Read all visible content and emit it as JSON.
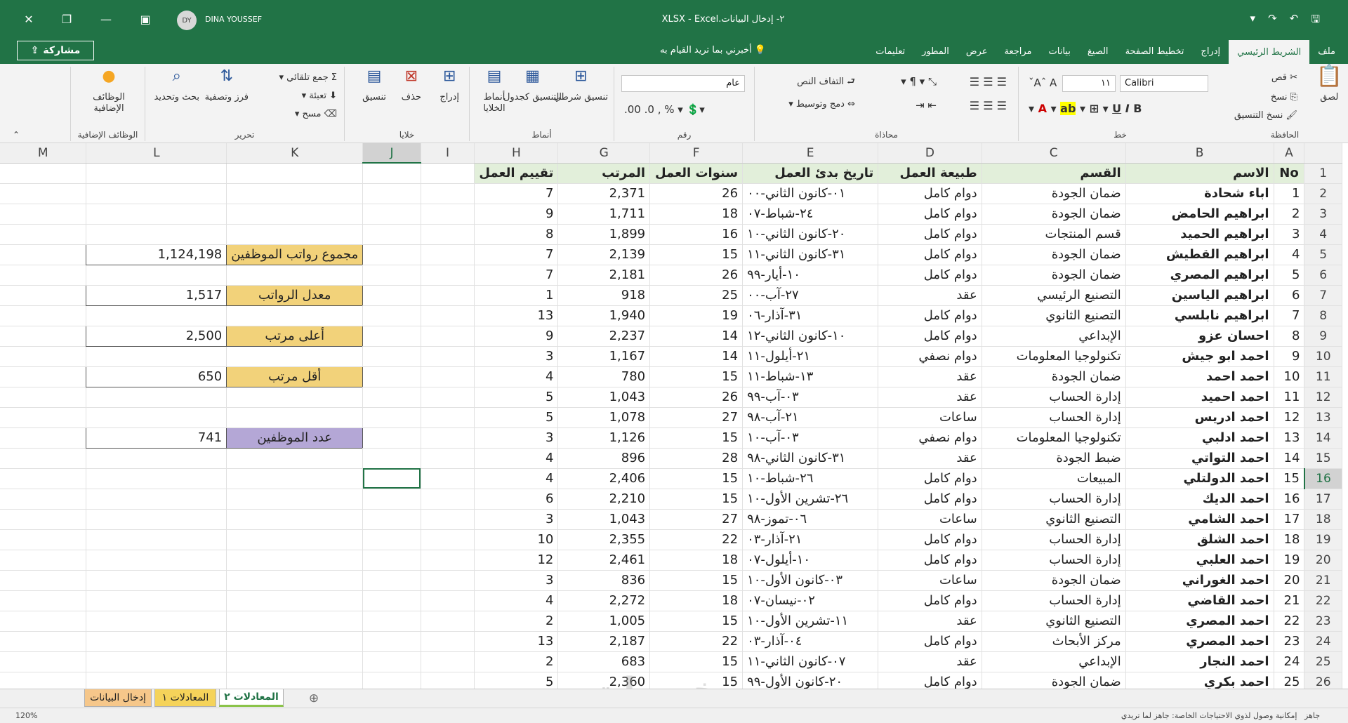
{
  "titlebar": {
    "user_initials": "DY",
    "user_name": "DINA YOUSSEF",
    "doc_title": "٢- إدخال البيانات.XLSX  -  Excel"
  },
  "share_label": "مشاركة",
  "tellme": "أخبرني بما تريد القيام به",
  "tabs": [
    "ملف",
    "الشريط الرئيسي",
    "إدراج",
    "تخطيط الصفحة",
    "الصيغ",
    "بيانات",
    "مراجعة",
    "عرض",
    "المطور",
    "تعليمات"
  ],
  "ribbon": {
    "clipboard": {
      "label": "الحافظة",
      "paste": "لصق",
      "cut": "قص",
      "copy": "نسخ",
      "format_painter": "نسخ التنسيق"
    },
    "font": {
      "label": "خط",
      "name": "Calibri",
      "size": "١١"
    },
    "alignment": {
      "label": "محاذاة",
      "wrap": "التفاف النص",
      "merge": "دمج وتوسيط"
    },
    "number": {
      "label": "رقم",
      "format": "عام"
    },
    "styles": {
      "label": "أنماط",
      "conditional": "تنسيق شرطي",
      "table": "التنسيق كجدول",
      "cell": "أنماط الخلايا"
    },
    "cells": {
      "label": "خلايا",
      "insert": "إدراج",
      "delete": "حذف",
      "format": "تنسيق"
    },
    "editing": {
      "label": "تحرير",
      "autosum": "جمع تلقائي",
      "fill": "تعبئة",
      "clear": "مسح",
      "sort": "فرز وتصفية",
      "find": "بحث وتحديد"
    },
    "addins": {
      "label": "الوظائف الإضافية",
      "btn": "الوظائف الإضافية"
    }
  },
  "columns": [
    "A",
    "B",
    "C",
    "D",
    "E",
    "F",
    "G",
    "H",
    "I",
    "J",
    "K",
    "L",
    "M"
  ],
  "header_row": {
    "no": "No",
    "name": "الاسم",
    "dept": "القسم",
    "type": "طبيعة العمل",
    "start": "تاريخ بدئ العمل",
    "years": "سنوات العمل",
    "salary": "المرتب",
    "rating": "تقييم العمل"
  },
  "rows": [
    {
      "r": "2",
      "no": "1",
      "name": "اباء شحادة",
      "dept": "ضمان الجودة",
      "type": "دوام كامل",
      "start": "٠١-كانون الثاني-٠٠",
      "years": "26",
      "salary": "2,371",
      "rating": "7"
    },
    {
      "r": "3",
      "no": "2",
      "name": "ابراهيم الحامض",
      "dept": "ضمان الجودة",
      "type": "دوام كامل",
      "start": "٢٤-شباط-٠٧",
      "years": "18",
      "salary": "1,711",
      "rating": "9"
    },
    {
      "r": "4",
      "no": "3",
      "name": "ابراهيم الحميد",
      "dept": "قسم المنتجات",
      "type": "دوام كامل",
      "start": "٢٠-كانون الثاني-١٠",
      "years": "16",
      "salary": "1,899",
      "rating": "8"
    },
    {
      "r": "5",
      "no": "4",
      "name": "ابراهيم القطيش",
      "dept": "ضمان الجودة",
      "type": "دوام كامل",
      "start": "٣١-كانون الثاني-١١",
      "years": "15",
      "salary": "2,139",
      "rating": "7"
    },
    {
      "r": "6",
      "no": "5",
      "name": "ابراهيم المصري",
      "dept": "ضمان الجودة",
      "type": "دوام كامل",
      "start": "١٠-أيار-٩٩",
      "years": "26",
      "salary": "2,181",
      "rating": "7"
    },
    {
      "r": "7",
      "no": "6",
      "name": "ابراهيم الياسين",
      "dept": "التصنيع الرئيسي",
      "type": "عقد",
      "start": "٢٧-آب-٠٠",
      "years": "25",
      "salary": "918",
      "rating": "1"
    },
    {
      "r": "8",
      "no": "7",
      "name": "ابراهيم نابلسي",
      "dept": "التصنيع الثانوي",
      "type": "دوام كامل",
      "start": "٣١-آذار-٠٦",
      "years": "19",
      "salary": "1,940",
      "rating": "13"
    },
    {
      "r": "9",
      "no": "8",
      "name": "احسان عزو",
      "dept": "الإبداعي",
      "type": "دوام كامل",
      "start": "١٠-كانون الثاني-١٢",
      "years": "14",
      "salary": "2,237",
      "rating": "9"
    },
    {
      "r": "10",
      "no": "9",
      "name": "احمد ابو جيش",
      "dept": "تكنولوجيا المعلومات",
      "type": "دوام نصفي",
      "start": "٢١-أيلول-١١",
      "years": "14",
      "salary": "1,167",
      "rating": "3"
    },
    {
      "r": "11",
      "no": "10",
      "name": "احمد احمد",
      "dept": "ضمان الجودة",
      "type": "عقد",
      "start": "١٣-شباط-١١",
      "years": "15",
      "salary": "780",
      "rating": "4"
    },
    {
      "r": "12",
      "no": "11",
      "name": "احمد احميد",
      "dept": "إدارة الحساب",
      "type": "عقد",
      "start": "٠٣-آب-٩٩",
      "years": "26",
      "salary": "1,043",
      "rating": "5"
    },
    {
      "r": "13",
      "no": "12",
      "name": "احمد ادريس",
      "dept": "إدارة الحساب",
      "type": "ساعات",
      "start": "٢١-آب-٩٨",
      "years": "27",
      "salary": "1,078",
      "rating": "5"
    },
    {
      "r": "14",
      "no": "13",
      "name": "احمد ادلبي",
      "dept": "تكنولوجيا المعلومات",
      "type": "دوام نصفي",
      "start": "٠٣-آب-١٠",
      "years": "15",
      "salary": "1,126",
      "rating": "3"
    },
    {
      "r": "15",
      "no": "14",
      "name": "احمد التواتي",
      "dept": "ضبط الجودة",
      "type": "عقد",
      "start": "٣١-كانون الثاني-٩٨",
      "years": "28",
      "salary": "896",
      "rating": "4"
    },
    {
      "r": "16",
      "no": "15",
      "name": "احمد الدولتلي",
      "dept": "المبيعات",
      "type": "دوام كامل",
      "start": "٢٦-شباط-١٠",
      "years": "15",
      "salary": "2,406",
      "rating": "4"
    },
    {
      "r": "17",
      "no": "16",
      "name": "احمد الديك",
      "dept": "إدارة الحساب",
      "type": "دوام كامل",
      "start": "٢٦-تشرين الأول-١٠",
      "years": "15",
      "salary": "2,210",
      "rating": "6"
    },
    {
      "r": "18",
      "no": "17",
      "name": "احمد الشامي",
      "dept": "التصنيع الثانوي",
      "type": "ساعات",
      "start": "٠٦-تموز-٩٨",
      "years": "27",
      "salary": "1,043",
      "rating": "3"
    },
    {
      "r": "19",
      "no": "18",
      "name": "احمد الشلق",
      "dept": "إدارة الحساب",
      "type": "دوام كامل",
      "start": "٢١-آذار-٠٣",
      "years": "22",
      "salary": "2,355",
      "rating": "10"
    },
    {
      "r": "20",
      "no": "19",
      "name": "احمد العلبي",
      "dept": "إدارة الحساب",
      "type": "دوام كامل",
      "start": "١٠-أيلول-٠٧",
      "years": "18",
      "salary": "2,461",
      "rating": "12"
    },
    {
      "r": "21",
      "no": "20",
      "name": "احمد الغوراني",
      "dept": "ضمان الجودة",
      "type": "ساعات",
      "start": "٠٣-كانون الأول-١٠",
      "years": "15",
      "salary": "836",
      "rating": "3"
    },
    {
      "r": "22",
      "no": "21",
      "name": "احمد القاضي",
      "dept": "إدارة الحساب",
      "type": "دوام كامل",
      "start": "٠٢-نيسان-٠٧",
      "years": "18",
      "salary": "2,272",
      "rating": "4"
    },
    {
      "r": "23",
      "no": "22",
      "name": "احمد المصري",
      "dept": "التصنيع الثانوي",
      "type": "عقد",
      "start": "١١-تشرين الأول-١٠",
      "years": "15",
      "salary": "1,005",
      "rating": "2"
    },
    {
      "r": "24",
      "no": "23",
      "name": "احمد المصري",
      "dept": "مركز الأبحاث",
      "type": "دوام كامل",
      "start": "٠٤-آذار-٠٣",
      "years": "22",
      "salary": "2,187",
      "rating": "13"
    },
    {
      "r": "25",
      "no": "24",
      "name": "احمد النجار",
      "dept": "الإبداعي",
      "type": "عقد",
      "start": "٠٧-كانون الثاني-١١",
      "years": "15",
      "salary": "683",
      "rating": "2"
    },
    {
      "r": "26",
      "no": "25",
      "name": "احمد بكري",
      "dept": "ضمان الجودة",
      "type": "دوام كامل",
      "start": "٢٠-كانون الأول-٩٩",
      "years": "15",
      "salary": "2,360",
      "rating": "5"
    }
  ],
  "summary": {
    "total_label": "مجموع رواتب الموظفين",
    "total_value": "1,124,198",
    "avg_label": "معدل الرواتب",
    "avg_value": "1,517",
    "max_label": "أعلى مرتب",
    "max_value": "2,500",
    "min_label": "أقل مرتب",
    "min_value": "650",
    "count_label": "عدد الموظفين",
    "count_value": "741"
  },
  "sheets": [
    "إدخال البيانات",
    "المعادلات ١",
    "المعادلات ٢"
  ],
  "status": {
    "left": "جاهز",
    "accessibility": "إمكانية وصول لذوي الاحتياجات الخاصة: جاهز لما تريدي",
    "zoom": "120%"
  },
  "watermark": "خمسات"
}
